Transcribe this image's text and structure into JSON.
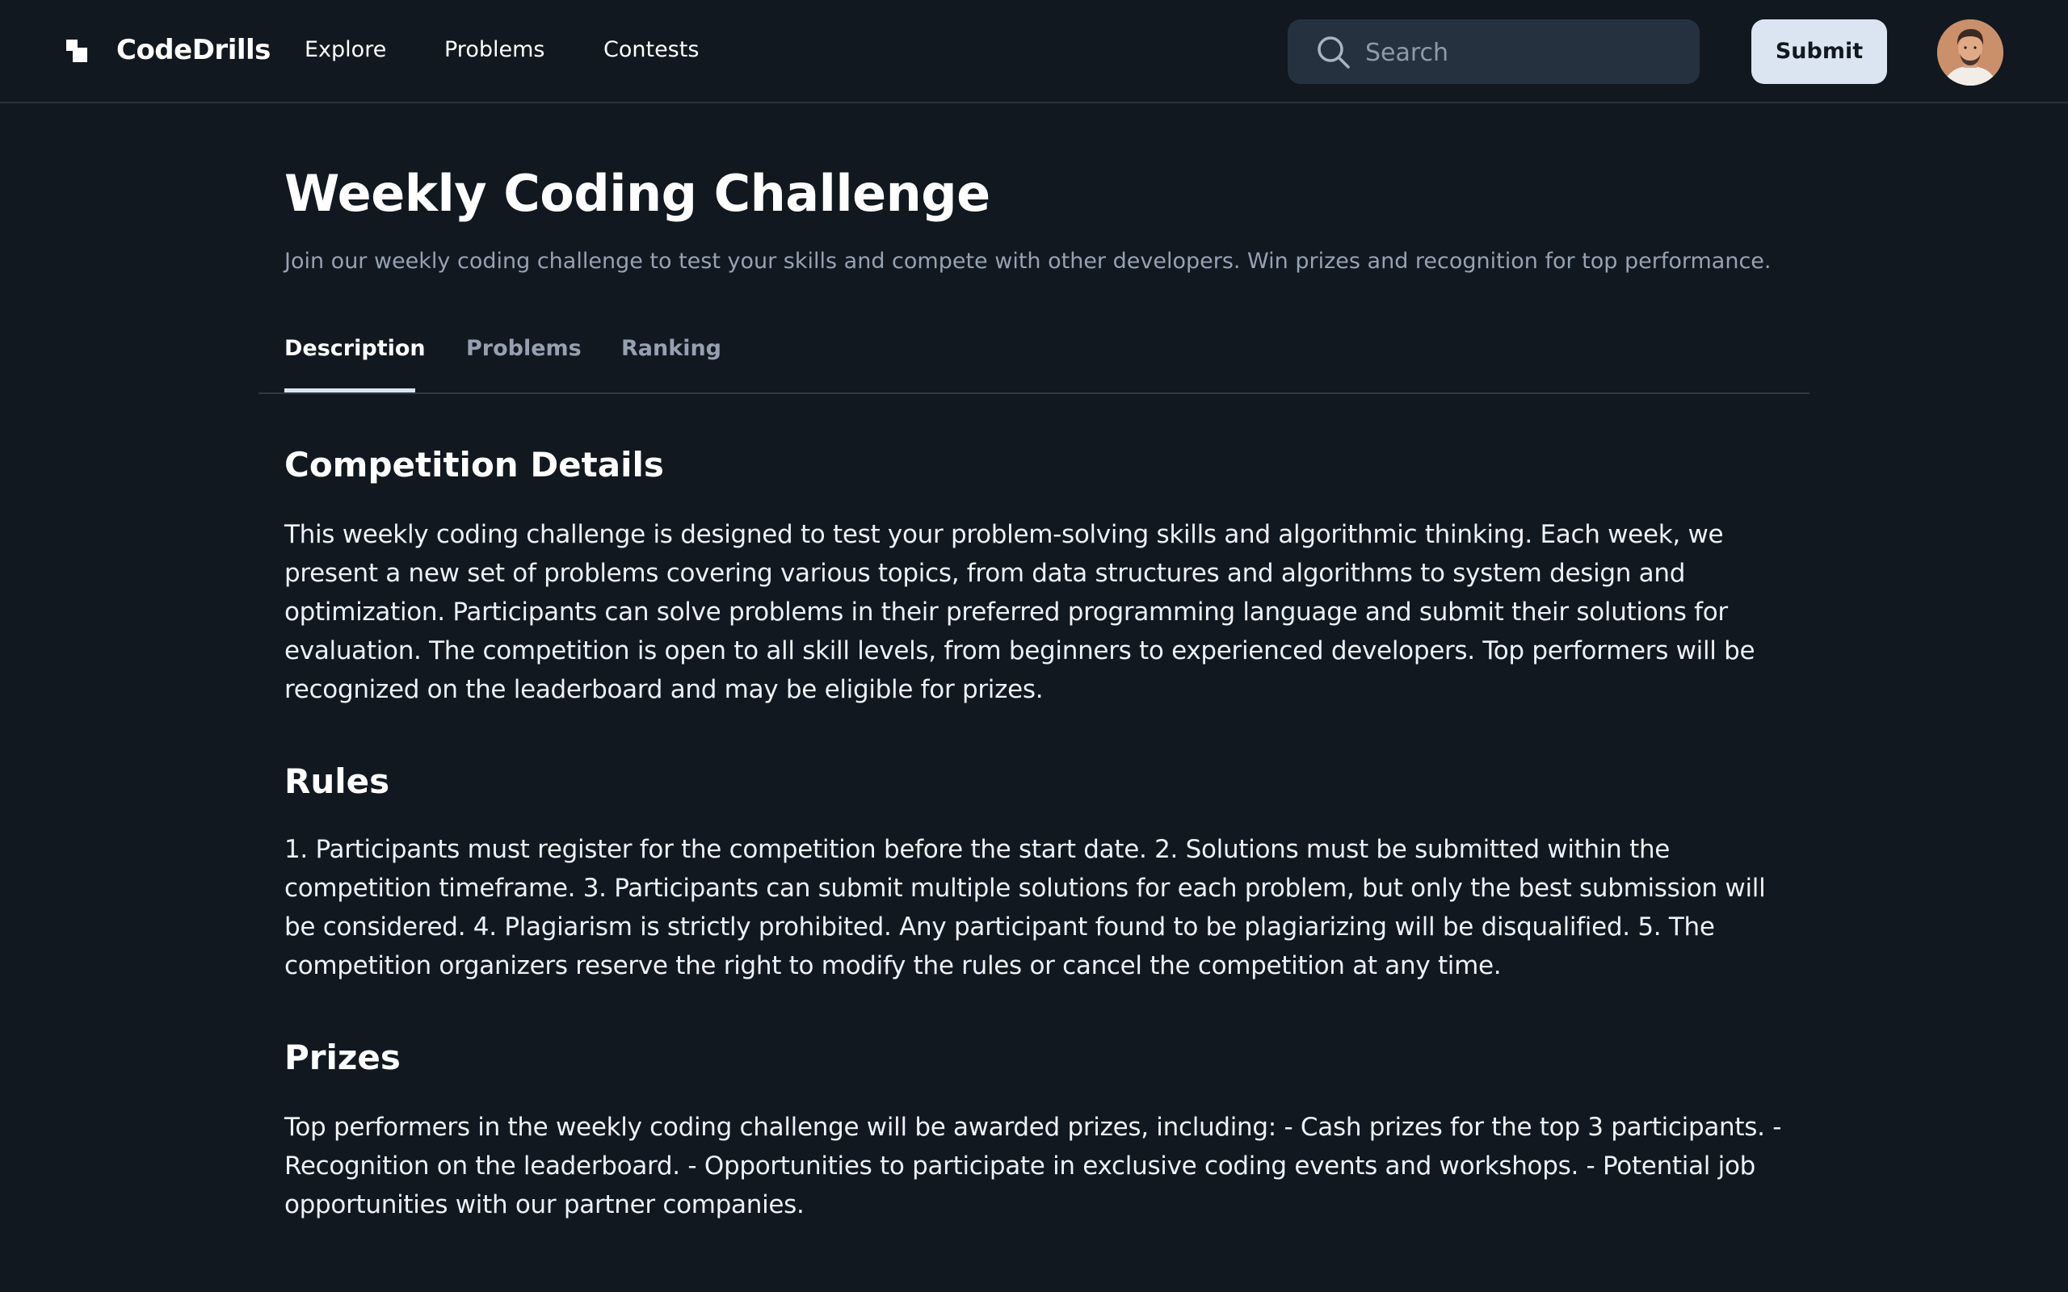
{
  "header": {
    "brand": "CodeDrills",
    "nav": [
      "Explore",
      "Problems",
      "Contests"
    ],
    "search_placeholder": "Search",
    "submit_label": "Submit",
    "logo_icon": "codedrills-logo-icon",
    "search_icon": "search-icon",
    "avatar": "user-avatar"
  },
  "page": {
    "title": "Weekly Coding Challenge",
    "subtitle": "Join our weekly coding challenge to test your skills and compete with other developers. Win prizes and recognition for top performance."
  },
  "tabs": {
    "items": [
      "Description",
      "Problems",
      "Ranking"
    ],
    "active": "Description"
  },
  "sections": [
    {
      "heading": "Competition Details",
      "body": "This weekly coding challenge is designed to test your problem-solving skills and algorithmic thinking. Each week, we present a new set of problems covering various topics, from data structures and algorithms to system design and optimization. Participants can solve problems in their preferred programming language and submit their solutions for evaluation. The competition is open to all skill levels, from beginners to experienced developers. Top performers will be recognized on the leaderboard and may be eligible for prizes."
    },
    {
      "heading": "Rules",
      "body": "1. Participants must register for the competition before the start date. 2. Solutions must be submitted within the competition timeframe. 3. Participants can submit multiple solutions for each problem, but only the best submission will be considered. 4. Plagiarism is strictly prohibited. Any participant found to be plagiarizing will be disqualified. 5. The competition organizers reserve the right to modify the rules or cancel the competition at any time."
    },
    {
      "heading": "Prizes",
      "body": "Top performers in the weekly coding challenge will be awarded prizes, including: - Cash prizes for the top 3 participants. - Recognition on the leaderboard. - Opportunities to participate in exclusive coding events and workshops. - Potential job opportunities with our partner companies."
    }
  ],
  "colors": {
    "background": "#111820",
    "search_bg": "#263140",
    "submit_bg": "#dbe5f2",
    "muted_text": "#97a2b2"
  }
}
